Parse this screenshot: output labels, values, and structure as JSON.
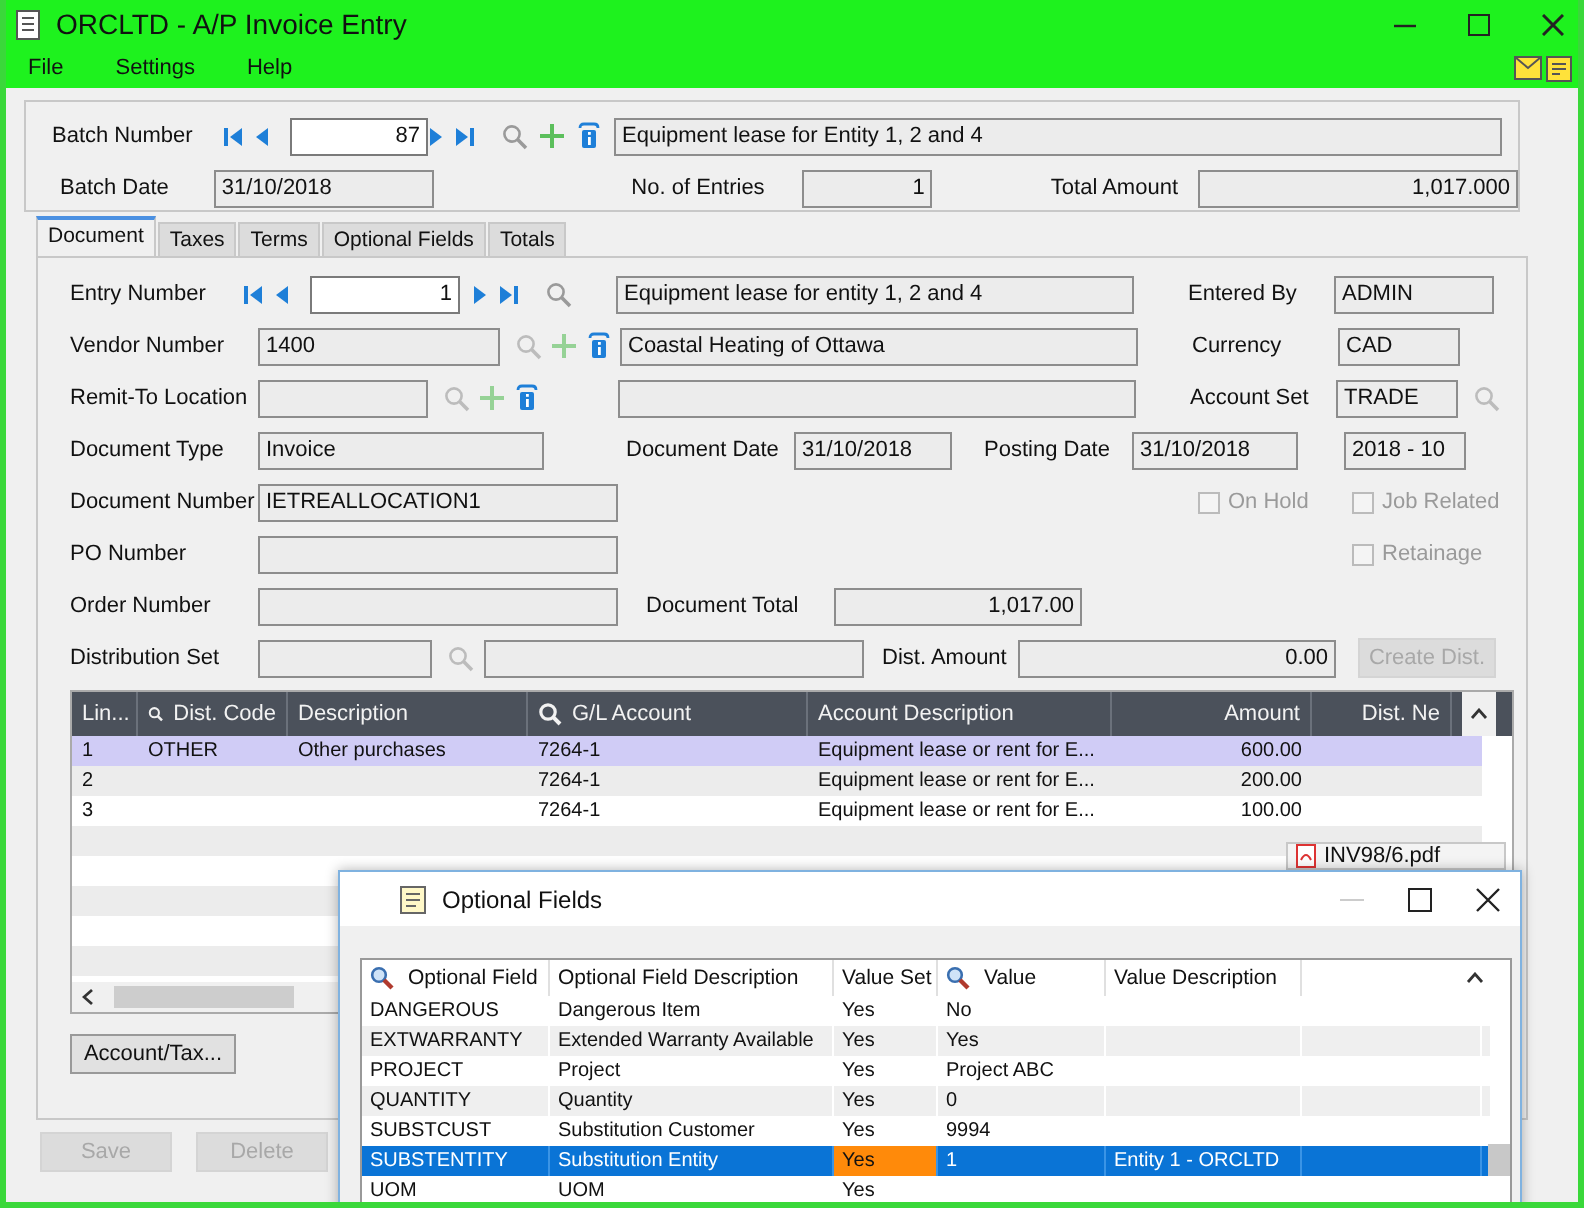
{
  "window": {
    "title": "ORCLTD - A/P Invoice Entry"
  },
  "menu": [
    {
      "label": "File"
    },
    {
      "label": "Settings"
    },
    {
      "label": "Help"
    }
  ],
  "batch": {
    "number_label": "Batch Number",
    "number": "87",
    "description": "Equipment lease for Entity 1, 2 and 4",
    "date_label": "Batch Date",
    "date": "31/10/2018",
    "entries_label": "No. of Entries",
    "entries": "1",
    "total_label": "Total Amount",
    "total": "1,017.000"
  },
  "tabs": [
    {
      "label": "Document",
      "selected": true
    },
    {
      "label": "Taxes",
      "selected": false
    },
    {
      "label": "Terms",
      "selected": false
    },
    {
      "label": "Optional Fields",
      "selected": false
    },
    {
      "label": "Totals",
      "selected": false
    }
  ],
  "document": {
    "entry_number": {
      "label": "Entry Number",
      "value": "1",
      "description": "Equipment lease for entity 1, 2 and 4"
    },
    "entered_by": {
      "label": "Entered By",
      "value": "ADMIN"
    },
    "vendor_number": {
      "label": "Vendor Number",
      "value": "1400",
      "name": "Coastal Heating of Ottawa"
    },
    "currency": {
      "label": "Currency",
      "value": "CAD"
    },
    "remit_to": {
      "label": "Remit-To Location"
    },
    "account_set": {
      "label": "Account Set",
      "value": "TRADE"
    },
    "document_type": {
      "label": "Document Type",
      "value": "Invoice"
    },
    "document_date": {
      "label": "Document Date",
      "value": "31/10/2018"
    },
    "posting_date": {
      "label": "Posting Date",
      "value": "31/10/2018",
      "period": "2018 - 10"
    },
    "document_number": {
      "label": "Document Number",
      "value": "IETREALLOCATION1"
    },
    "po_number": {
      "label": "PO Number"
    },
    "order_number": {
      "label": "Order Number"
    },
    "document_total": {
      "label": "Document Total",
      "value": "1,017.00"
    },
    "distribution_set": {
      "label": "Distribution Set"
    },
    "dist_amount": {
      "label": "Dist. Amount",
      "value": "0.00"
    },
    "create_dist": {
      "label": "Create Dist.",
      "disabled": true
    },
    "checkboxes": [
      {
        "label": "On Hold",
        "checked": false,
        "disabled": true
      },
      {
        "label": "Job Related",
        "checked": false,
        "disabled": true
      },
      {
        "label": "Retainage",
        "checked": false,
        "disabled": true
      }
    ]
  },
  "lines": {
    "columns": [
      {
        "label": "Lin...",
        "search": false
      },
      {
        "label": "Dist. Code",
        "search": true
      },
      {
        "label": "Description",
        "search": false
      },
      {
        "label": "G/L Account",
        "search": true
      },
      {
        "label": "Account Description",
        "search": false
      },
      {
        "label": "Amount",
        "search": false
      },
      {
        "label": "Dist. Ne",
        "search": false
      }
    ],
    "rows": [
      {
        "line": "1",
        "dist_code": "OTHER",
        "description": "Other purchases",
        "gl_account": "7264-1",
        "account_description": "Equipment lease or rent for E...",
        "amount": "600.00",
        "selected": true
      },
      {
        "line": "2",
        "gl_account": "7264-1",
        "account_description": "Equipment lease or rent for E...",
        "amount": "200.00",
        "selected": false
      },
      {
        "line": "3",
        "gl_account": "7264-1",
        "account_description": "Equipment lease or rent for E...",
        "amount": "100.00",
        "selected": false
      }
    ]
  },
  "account_tax": {
    "label": "Account/Tax...",
    "disabled": false
  },
  "actions": [
    {
      "label": "Save",
      "disabled": true
    },
    {
      "label": "Delete",
      "disabled": true
    }
  ],
  "attachment": {
    "file": "INV98/6.pdf"
  },
  "popup": {
    "title": "Optional Fields",
    "columns": [
      {
        "label": "Optional Field",
        "search": true
      },
      {
        "label": "Optional Field Description",
        "search": false
      },
      {
        "label": "Value Set",
        "search": false
      },
      {
        "label": "Value",
        "search": true
      },
      {
        "label": "Value Description",
        "search": false
      }
    ],
    "rows": [
      {
        "field": "DANGEROUS",
        "description": "Dangerous Item",
        "value_set": "Yes",
        "value": "No",
        "selected": false,
        "value_set_focused": false
      },
      {
        "field": "EXTWARRANTY",
        "description": "Extended Warranty Available",
        "value_set": "Yes",
        "value": "Yes",
        "selected": false,
        "value_set_focused": false
      },
      {
        "field": "PROJECT",
        "description": "Project",
        "value_set": "Yes",
        "value": "Project ABC",
        "selected": false,
        "value_set_focused": false
      },
      {
        "field": "QUANTITY",
        "description": "Quantity",
        "value_set": "Yes",
        "value": "0",
        "selected": false,
        "value_set_focused": false
      },
      {
        "field": "SUBSTCUST",
        "description": "Substitution Customer",
        "value_set": "Yes",
        "value": "9994",
        "selected": false,
        "value_set_focused": false
      },
      {
        "field": "SUBSTENTITY",
        "description": "Substitution Entity",
        "value_set": "Yes",
        "value": "1",
        "value_description": "Entity 1 - ORCLTD",
        "selected": true,
        "value_set_focused": true
      },
      {
        "field": "UOM",
        "description": "UOM",
        "value_set": "Yes",
        "selected": false,
        "value_set_focused": false
      }
    ]
  }
}
